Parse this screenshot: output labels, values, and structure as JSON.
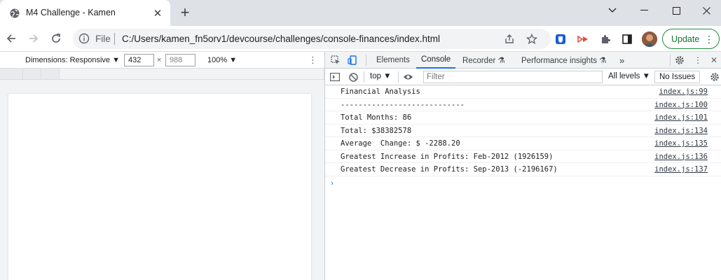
{
  "browser": {
    "tab_title": "M4 Challenge - Kamen",
    "omnibox_scheme": "File",
    "url": "C:/Users/kamen_fn5orv1/devcourse/challenges/console-finances/index.html",
    "update_label": "Update"
  },
  "device_toolbar": {
    "dimensions_label": "Dimensions: Responsive ▼",
    "width_value": "432",
    "times": "×",
    "height_value": "988",
    "zoom_label": "100% ▼"
  },
  "devtools": {
    "tabs": [
      "Elements",
      "Console",
      "Recorder ⚗",
      "Performance insights ⚗"
    ],
    "more": "»",
    "context": "top ▼",
    "filter_placeholder": "Filter",
    "levels": "All levels ▼",
    "issues": "No Issues"
  },
  "console": {
    "rows": [
      {
        "message": "Financial Analysis",
        "source": "index.js:99"
      },
      {
        "message": "----------------------------",
        "source": "index.js:100"
      },
      {
        "message": "Total Months: 86",
        "source": "index.js:101"
      },
      {
        "message": "Total: $38382578",
        "source": "index.js:134"
      },
      {
        "message": "Average  Change: $ -2288.20",
        "source": "index.js:135"
      },
      {
        "message": "Greatest Increase in Profits: Feb-2012 (1926159)",
        "source": "index.js:136"
      },
      {
        "message": "Greatest Decrease in Profits: Sep-2013 (-2196167)",
        "source": "index.js:137"
      }
    ],
    "prompt": "›"
  },
  "colors": {
    "accent": "#1a73e8",
    "update_green": "#1e8e3e",
    "tabstrip": "#dee1e6"
  }
}
